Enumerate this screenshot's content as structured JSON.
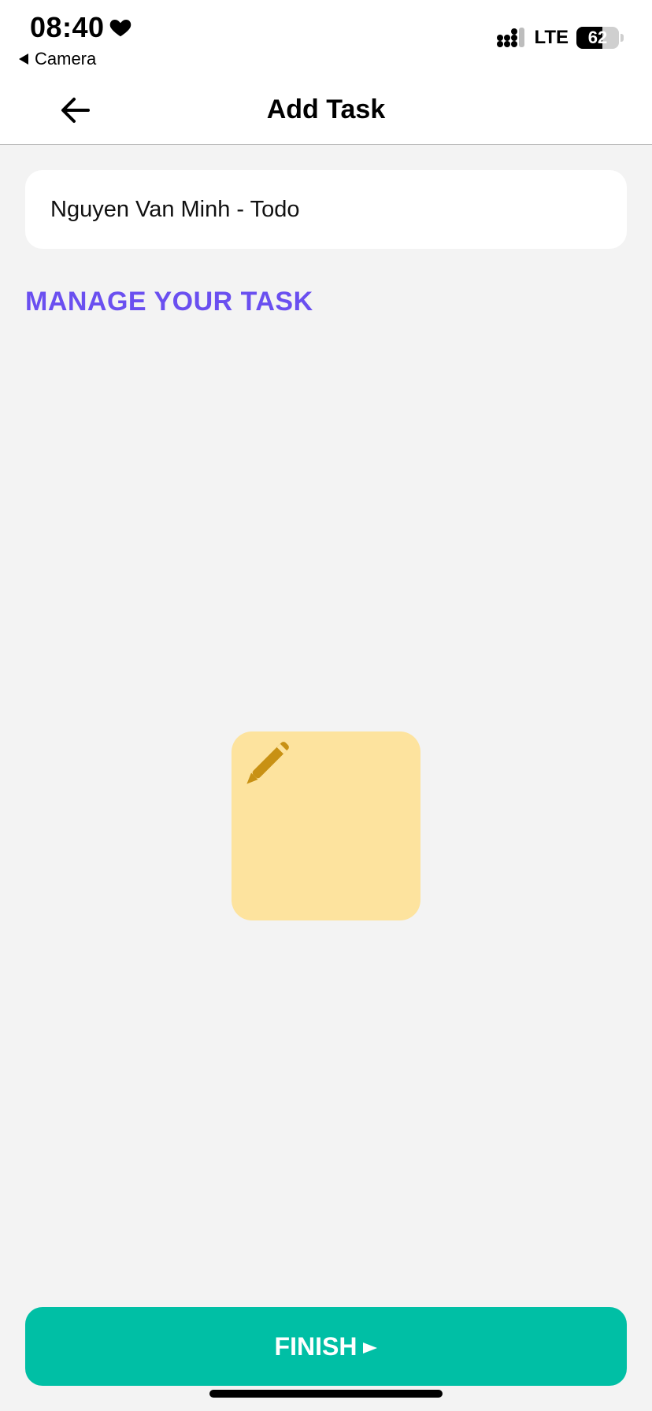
{
  "status_bar": {
    "time": "08:40",
    "back_app": "Camera",
    "network": "LTE",
    "battery": "62",
    "battery_fraction": 0.62,
    "icons": [
      "heart-icon",
      "signal-icon",
      "battery-icon"
    ]
  },
  "header": {
    "title": "Add Task",
    "back_icon": "arrow-left-icon"
  },
  "task": {
    "name": "Nguyen Van Minh - Todo"
  },
  "section": {
    "title": "MANAGE YOUR TASK"
  },
  "note": {
    "icon": "pencil-icon",
    "color": "#fde39e"
  },
  "footer": {
    "finish_label": "FINISH",
    "finish_icon": "play-arrow-icon",
    "accent": "#00bfa5"
  },
  "colors": {
    "section_title": "#6a4ff0",
    "background": "#f3f3f3",
    "pencil": "#c89114"
  }
}
